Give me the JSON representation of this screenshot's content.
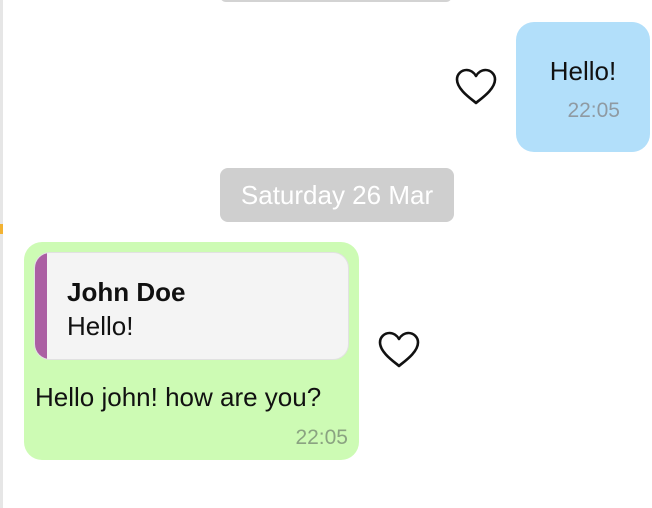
{
  "messages": {
    "outgoing": {
      "text": "Hello!",
      "time": "22:05",
      "like_icon": "heart-outline-icon"
    },
    "date_divider": "Saturday 26 Mar",
    "incoming": {
      "reply": {
        "author": "John Doe",
        "text": "Hello!"
      },
      "text": "Hello john! how are you?",
      "time": "22:05",
      "like_icon": "heart-outline-icon"
    }
  },
  "colors": {
    "outgoing_bubble": "#b2dffa",
    "incoming_bubble": "#cdfbb4",
    "reply_accent": "#ab5fa3",
    "date_chip": "#cfcfcf"
  }
}
